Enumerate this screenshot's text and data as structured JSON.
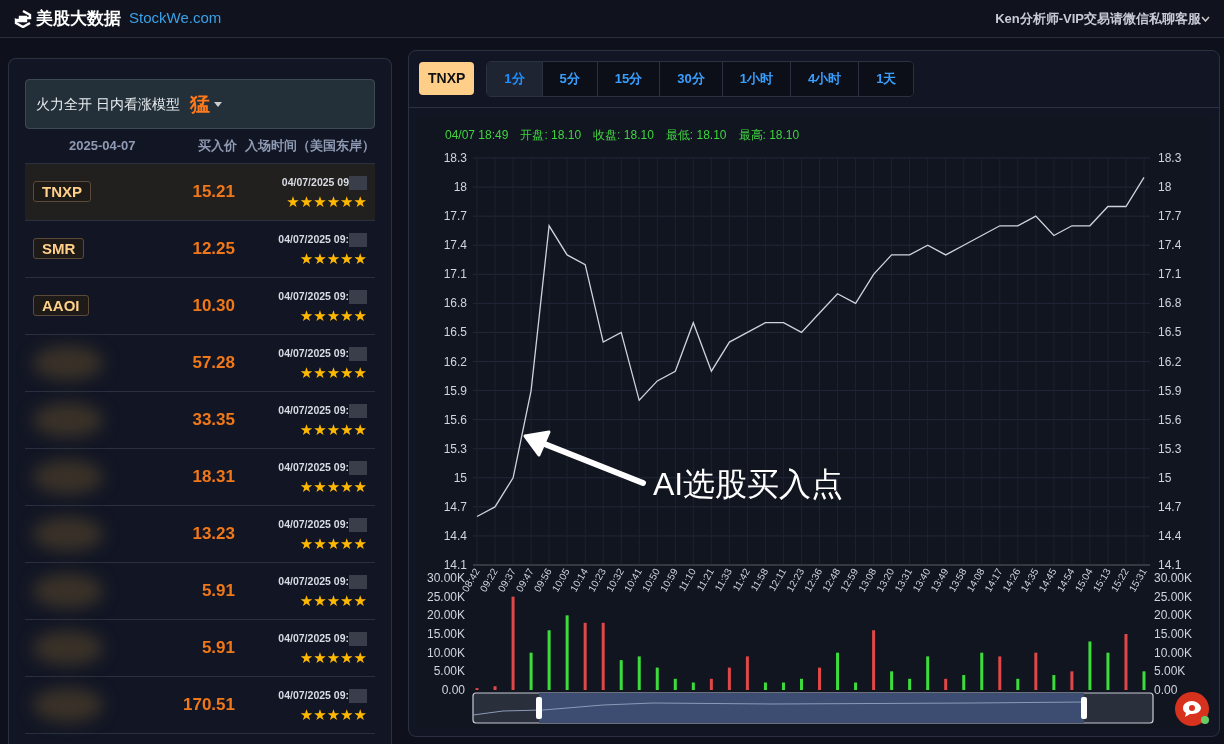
{
  "header": {
    "logo_text": "美股大数据",
    "logo_domain": "StockWe.com",
    "user_menu": "Ken分析师-VIP交易请微信私聊客服"
  },
  "model_select": {
    "label": "火力全开 日内看涨模型",
    "level_text": "猛"
  },
  "list_header": {
    "date": "2025-04-07",
    "price": "买入价",
    "time": "入场时间（美国东岸）"
  },
  "picks": [
    {
      "ticker": "TNXP",
      "price": "15.21",
      "time": "04/07/2025 09",
      "stars": 6,
      "selected": true
    },
    {
      "ticker": "SMR",
      "price": "12.25",
      "time": "04/07/2025 09:",
      "stars": 5,
      "selected": false
    },
    {
      "ticker": "AAOI",
      "price": "10.30",
      "time": "04/07/2025 09:",
      "stars": 5,
      "selected": false
    },
    {
      "price": "57.28",
      "time": "04/07/2025 09:",
      "stars": 5,
      "selected": false
    },
    {
      "price": "33.35",
      "time": "04/07/2025 09:",
      "stars": 5,
      "selected": false
    },
    {
      "price": "18.31",
      "time": "04/07/2025 09:",
      "stars": 5,
      "selected": false
    },
    {
      "price": "13.23",
      "time": "04/07/2025 09:",
      "stars": 5,
      "selected": false
    },
    {
      "price": "5.91",
      "time": "04/07/2025 09:",
      "stars": 5,
      "selected": false
    },
    {
      "price": "5.91",
      "time": "04/07/2025 09:",
      "stars": 5,
      "selected": false
    },
    {
      "price": "170.51",
      "time": "04/07/2025 09:",
      "stars": 5,
      "selected": false
    }
  ],
  "chart_panel": {
    "symbol": "TNXP",
    "intervals": [
      {
        "label": "1分",
        "selected": true
      },
      {
        "label": "5分",
        "selected": false
      },
      {
        "label": "15分",
        "selected": false
      },
      {
        "label": "30分",
        "selected": false
      },
      {
        "label": "1小时",
        "selected": false
      },
      {
        "label": "4小时",
        "selected": false
      },
      {
        "label": "1天",
        "selected": false
      }
    ],
    "info": [
      "04/07 18:49",
      "开盘: 18.10",
      "收盘: 18.10",
      "最低: 18.10",
      "最高: 18.10"
    ],
    "price_chart": {
      "chart_data": {
        "type": "line",
        "grid": true,
        "categories": [
          "08:42",
          "09:22",
          "09:37",
          "09:47",
          "09:56",
          "10:05",
          "10:14",
          "10:23",
          "10:32",
          "10:41",
          "10:50",
          "10:59",
          "11:10",
          "11:21",
          "11:33",
          "11:42",
          "11:58",
          "12:11",
          "12:23",
          "12:36",
          "12:48",
          "12:59",
          "13:08",
          "13:20",
          "13:31",
          "13:40",
          "13:49",
          "13:58",
          "14:08",
          "14:17",
          "14:26",
          "14:35",
          "14:45",
          "14:54",
          "15:04",
          "15:13",
          "15:22",
          "15:31"
        ],
        "series": [
          {
            "color": "#cfd3dc",
            "values": [
              14.6,
              14.7,
              15.0,
              15.9,
              17.6,
              17.3,
              17.2,
              16.4,
              16.5,
              15.8,
              16.0,
              16.1,
              16.6,
              16.1,
              16.4,
              16.5,
              16.6,
              16.6,
              16.5,
              16.7,
              16.9,
              16.8,
              17.1,
              17.3,
              17.3,
              17.4,
              17.3,
              17.4,
              17.5,
              17.6,
              17.6,
              17.7,
              17.5,
              17.6,
              17.6,
              17.8,
              17.8,
              18.1
            ]
          }
        ],
        "ylim": [
          14.1,
          18.3
        ],
        "yticks": [
          14.1,
          14.4,
          14.7,
          15,
          15.3,
          15.6,
          15.9,
          16.2,
          16.5,
          16.8,
          17.1,
          17.4,
          17.7,
          18,
          18.3
        ],
        "y2lim": [
          14.1,
          18.3
        ],
        "y2ticks": [
          14.1,
          14.4,
          14.7,
          15,
          15.3,
          15.6,
          15.9,
          16.2,
          16.5,
          16.8,
          17.1,
          17.4,
          17.7,
          18,
          18.3
        ],
        "annotations": [
          "AI选股买入点"
        ]
      }
    },
    "volume_chart": {
      "chart_data": {
        "type": "bar",
        "series": [
          {
            "color": "#3ddc3d",
            "values": [
              null,
              null,
              null,
              10,
              16,
              20,
              null,
              null,
              8,
              9,
              6,
              3,
              2,
              null,
              null,
              null,
              2,
              2,
              3,
              null,
              10,
              2,
              null,
              5,
              3,
              9,
              null,
              4,
              10,
              null,
              3,
              null,
              4,
              null,
              13,
              10,
              null,
              5
            ]
          },
          {
            "color": "#e04848",
            "values": [
              0.5,
              1,
              25,
              null,
              null,
              null,
              18,
              18,
              null,
              null,
              null,
              null,
              null,
              3,
              6,
              9,
              null,
              null,
              null,
              6,
              null,
              null,
              16,
              null,
              null,
              null,
              3,
              null,
              null,
              9,
              null,
              10,
              null,
              5,
              null,
              null,
              15,
              null
            ]
          }
        ],
        "ylim": [
          0,
          30
        ],
        "yticks": [
          {
            "value": 0,
            "label": "0.00"
          },
          {
            "value": 5,
            "label": "5.00K"
          },
          {
            "value": 10,
            "label": "10.00K"
          },
          {
            "value": 15,
            "label": "15.00K"
          },
          {
            "value": 20,
            "label": "20.00K"
          },
          {
            "value": 25,
            "label": "25.00K"
          },
          {
            "value": 30,
            "label": "30.00K"
          }
        ],
        "y2lim": [
          0,
          30
        ],
        "y2ticks": [
          {
            "value": 0,
            "label": "0.00"
          },
          {
            "value": 5,
            "label": "5.00K"
          },
          {
            "value": 10,
            "label": "10.00K"
          },
          {
            "value": 15,
            "label": "15.00K"
          },
          {
            "value": 20,
            "label": "20.00K"
          },
          {
            "value": 25,
            "label": "25.00K"
          },
          {
            "value": 30,
            "label": "30.00K"
          }
        ]
      }
    }
  }
}
